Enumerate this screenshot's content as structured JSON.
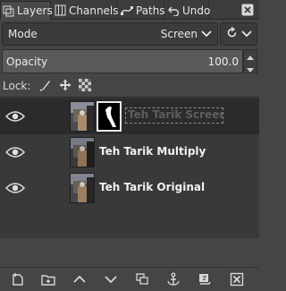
{
  "tabs": [
    {
      "label": "Layers",
      "icon": "layers-icon",
      "active": true
    },
    {
      "label": "Channels",
      "icon": "channels-icon",
      "active": false
    },
    {
      "label": "Paths",
      "icon": "paths-icon",
      "active": false
    },
    {
      "label": "Undo",
      "icon": "undo-icon",
      "active": false
    }
  ],
  "mode": {
    "label": "Mode",
    "value": "Screen"
  },
  "opacity": {
    "label": "Opacity",
    "value": "100.0"
  },
  "lock": {
    "label": "Lock:",
    "icons": [
      "lock-paint-icon",
      "lock-position-icon",
      "lock-alpha-icon"
    ]
  },
  "layers": [
    {
      "name": "Teh Tarik Screen",
      "visible": true,
      "selected": true,
      "has_mask": true,
      "editing": true
    },
    {
      "name": "Teh Tarik Multiply",
      "visible": true,
      "selected": false,
      "has_mask": false,
      "editing": false
    },
    {
      "name": "Teh Tarik Original",
      "visible": true,
      "selected": false,
      "has_mask": false,
      "editing": false
    }
  ],
  "bottom_toolbar": [
    "new-layer-icon",
    "new-layer-group-icon",
    "raise-layer-icon",
    "lower-layer-icon",
    "duplicate-layer-icon",
    "anchor-layer-icon",
    "add-mask-icon",
    "delete-layer-icon"
  ],
  "colors": {
    "background": "#454545",
    "list_bg": "#393939",
    "selected_row": "#2b2b2b"
  }
}
